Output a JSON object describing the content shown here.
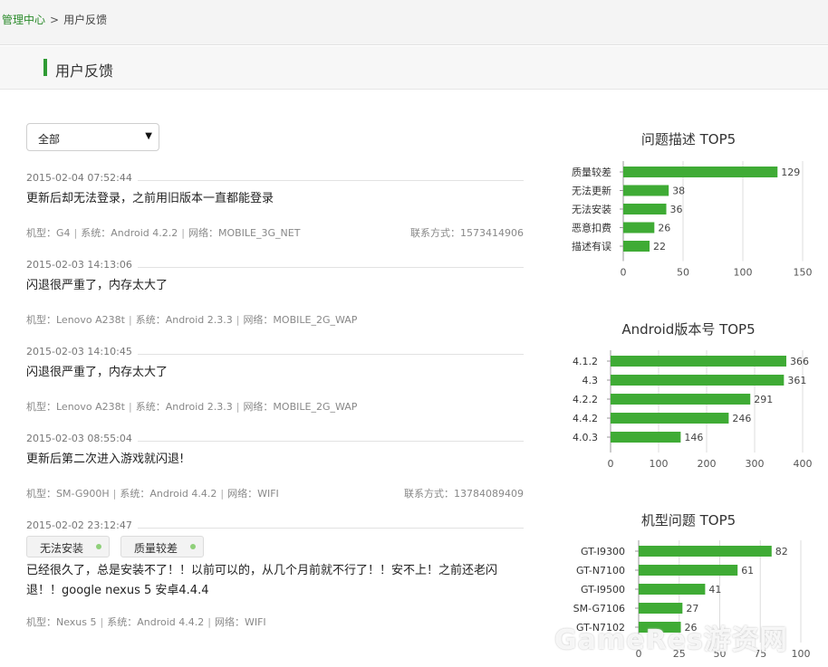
{
  "breadcrumb": {
    "parent": "管理中心",
    "separator": ">",
    "current": "用户反馈"
  },
  "header": {
    "title": "用户反馈"
  },
  "filter": {
    "selected": "全部",
    "arrow": "▼"
  },
  "feedback": [
    {
      "time": "2015-02-04 07:52:44",
      "message": "更新后却无法登录，之前用旧版本一直都能登录",
      "model": "机型：G4",
      "system": "系统：Android 4.2.2",
      "network": "网络：MOBILE_3G_NET",
      "contact": "联系方式：1573414906",
      "tags": []
    },
    {
      "time": "2015-02-03 14:13:06",
      "message": "闪退很严重了，内存太大了",
      "model": "机型：Lenovo A238t",
      "system": "系统：Android 2.3.3",
      "network": "网络：MOBILE_2G_WAP",
      "contact": "",
      "tags": []
    },
    {
      "time": "2015-02-03 14:10:45",
      "message": "闪退很严重了，内存太大了",
      "model": "机型：Lenovo A238t",
      "system": "系统：Android 2.3.3",
      "network": "网络：MOBILE_2G_WAP",
      "contact": "",
      "tags": []
    },
    {
      "time": "2015-02-03 08:55:04",
      "message": "更新后第二次进入游戏就闪退!",
      "model": "机型：SM-G900H",
      "system": "系统：Android 4.4.2",
      "network": "网络：WIFI",
      "contact": "联系方式：13784089409",
      "tags": []
    },
    {
      "time": "2015-02-02 23:12:47",
      "message": "已经很久了，总是安装不了！！以前可以的，从几个月前就不行了！！安不上！之前还老闪退！！google nexus 5 安卓4.4.4",
      "model": "机型：Nexus 5",
      "system": "系统：Android 4.4.2",
      "network": "网络：WIFI",
      "contact": "",
      "tags": [
        "无法安装",
        "质量较差"
      ]
    }
  ],
  "meta_separator": "|",
  "watermark": "GameRes游资网",
  "colors": {
    "bar": "#3fab35",
    "accent": "#2f9b34"
  },
  "chart_data": [
    {
      "type": "bar",
      "orientation": "horizontal",
      "title": "问题描述 TOP5",
      "categories": [
        "质量较差",
        "无法更新",
        "无法安装",
        "恶意扣费",
        "描述有误"
      ],
      "values": [
        129,
        38,
        36,
        26,
        22
      ],
      "xlim": [
        0,
        150
      ],
      "ticks": [
        0,
        50,
        100,
        150
      ],
      "grid": true
    },
    {
      "type": "bar",
      "orientation": "horizontal",
      "title": "Android版本号 TOP5",
      "categories": [
        "4.1.2",
        "4.3",
        "4.2.2",
        "4.4.2",
        "4.0.3"
      ],
      "values": [
        366,
        361,
        291,
        246,
        146
      ],
      "xlim": [
        0,
        400
      ],
      "ticks": [
        0,
        100,
        200,
        300,
        400
      ],
      "grid": true
    },
    {
      "type": "bar",
      "orientation": "horizontal",
      "title": "机型问题 TOP5",
      "categories": [
        "GT-I9300",
        "GT-N7100",
        "GT-I9500",
        "SM-G7106",
        "GT-N7102"
      ],
      "values": [
        82,
        61,
        41,
        27,
        26
      ],
      "xlim": [
        0,
        100
      ],
      "ticks": [
        0,
        25,
        50,
        75,
        100
      ],
      "grid": true
    }
  ]
}
